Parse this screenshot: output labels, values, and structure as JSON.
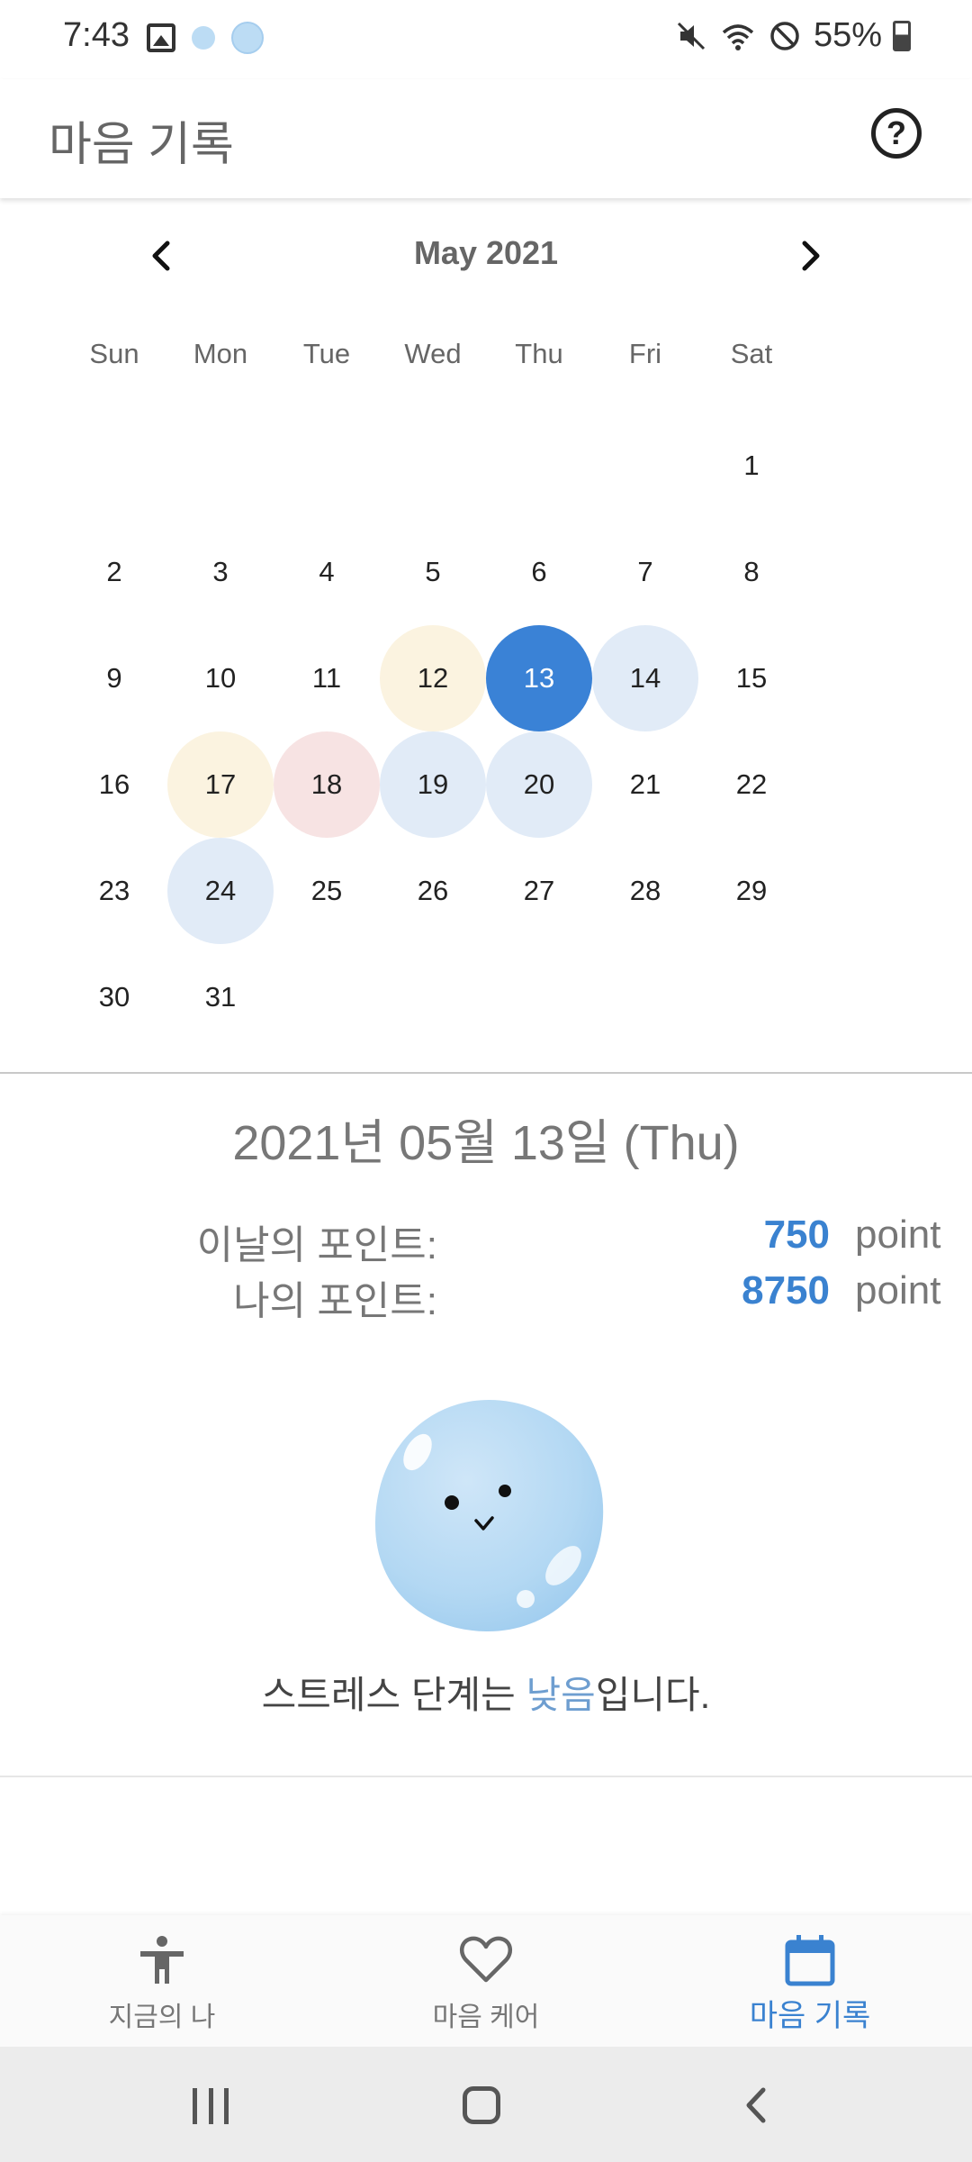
{
  "status_bar": {
    "time": "7:43",
    "battery": "55%"
  },
  "app_bar": {
    "title": "마음 기록",
    "help_label": "?"
  },
  "calendar": {
    "month_label": "May 2021",
    "weekdays": [
      "Sun",
      "Mon",
      "Tue",
      "Wed",
      "Thu",
      "Fri",
      "Sat"
    ],
    "weeks": [
      [
        "",
        "",
        "",
        "",
        "",
        "",
        "1"
      ],
      [
        "2",
        "3",
        "4",
        "5",
        "6",
        "7",
        "8"
      ],
      [
        "9",
        "10",
        "11",
        "12",
        "13",
        "14",
        "15"
      ],
      [
        "16",
        "17",
        "18",
        "19",
        "20",
        "21",
        "22"
      ],
      [
        "23",
        "24",
        "25",
        "26",
        "27",
        "28",
        "29"
      ],
      [
        "30",
        "31",
        "",
        "",
        "",
        "",
        ""
      ]
    ],
    "selected_day": "13",
    "marked_days": {
      "12": "#fbf3e0",
      "14": "#e1ebf7",
      "17": "#fbf3e0",
      "18": "#f7e3e3",
      "19": "#e1ebf7",
      "20": "#e1ebf7",
      "24": "#e1ebf7"
    },
    "selected_color": "#3a82d6"
  },
  "detail": {
    "date": "2021년 05월 13일 (Thu)",
    "day_points_label": "이날의 포인트:",
    "day_points_value": "750",
    "my_points_label": "나의 포인트:",
    "my_points_value": "8750",
    "point_unit": "point",
    "stress_prefix": "스트레스 단계는 ",
    "stress_level": "낮음",
    "stress_suffix": "입니다."
  },
  "bottom_nav": {
    "items": [
      {
        "label": "지금의 나",
        "icon": "person-icon"
      },
      {
        "label": "마음 케어",
        "icon": "heart-icon"
      },
      {
        "label": "마음 기록",
        "icon": "calendar-icon"
      }
    ],
    "active_index": 2
  },
  "colors": {
    "accent": "#3a82d0",
    "stress_highlight": "#6e9ed0"
  }
}
